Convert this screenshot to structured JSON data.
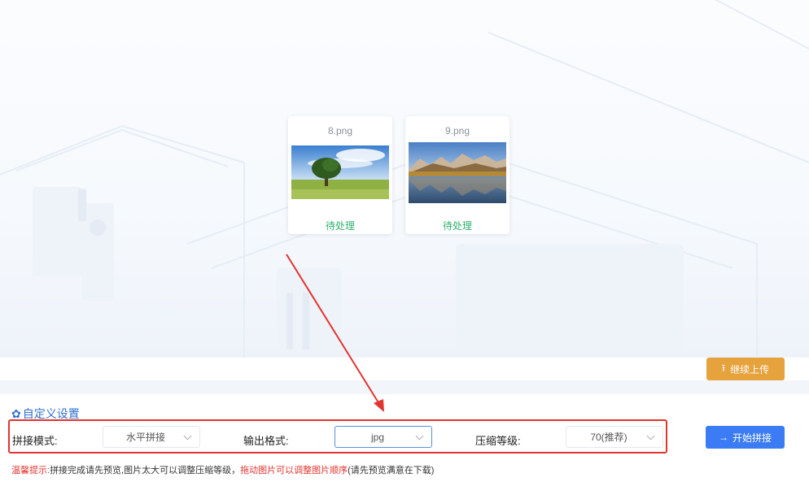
{
  "files": [
    {
      "name": "8.png",
      "status": "待处理",
      "image": "tree-landscape"
    },
    {
      "name": "9.png",
      "status": "待处理",
      "image": "mountain-lake"
    }
  ],
  "upload": {
    "continue_label": "继续上传",
    "icon": "upload-icon"
  },
  "settings": {
    "title": "自定义设置",
    "icon": "gear-icon",
    "mode": {
      "label": "拼接模式:",
      "value": "水平拼接"
    },
    "format": {
      "label": "输出格式:",
      "value": "jpg"
    },
    "compression": {
      "label": "压缩等级:",
      "value": "70(推荐)"
    },
    "start_label": "开始拼接"
  },
  "tip": {
    "prefix": "温馨提示:",
    "part1": "拼接完成请先预览,图片太大可以调整压缩等级，",
    "highlight": "拖动图片可以调整图片顺序",
    "part2": "(请先预览满意在下载)"
  },
  "colors": {
    "accent": "#3b7cf4",
    "warning": "#e6a23c",
    "success": "#2fb06c",
    "annotation": "#e3342f"
  }
}
